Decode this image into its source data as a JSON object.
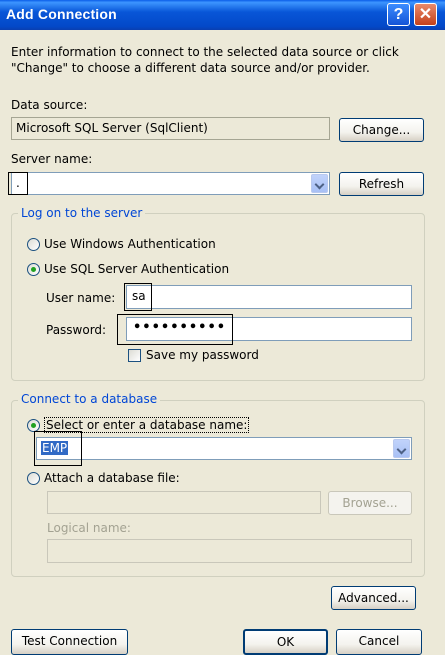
{
  "window": {
    "title": "Add Connection",
    "help_label": "?",
    "close_label": "✕"
  },
  "intro": "Enter information to connect to the selected data source or click \"Change\" to choose a different data source and/or provider.",
  "data_source": {
    "label": "Data source:",
    "value": "Microsoft SQL Server (SqlClient)",
    "change_button": "Change..."
  },
  "server": {
    "label": "Server name:",
    "value": ".",
    "refresh_button": "Refresh"
  },
  "logon": {
    "legend": "Log on to the server",
    "windows_auth": "Use Windows Authentication",
    "sql_auth": "Use SQL Server Authentication",
    "selected": "sql_auth",
    "username_label": "User name:",
    "username_value": "sa",
    "password_label": "Password:",
    "password_value": "••••••••••",
    "save_password": "Save my password",
    "save_password_checked": false
  },
  "database": {
    "legend": "Connect to a database",
    "select_option": "Select or enter a database name:",
    "select_value": "EMP",
    "attach_option": "Attach a database file:",
    "attach_value": "",
    "browse_button": "Browse...",
    "logical_name_label": "Logical name:",
    "logical_name_value": "",
    "selected": "select"
  },
  "buttons": {
    "advanced": "Advanced...",
    "test_connection": "Test Connection",
    "ok": "OK",
    "cancel": "Cancel"
  }
}
